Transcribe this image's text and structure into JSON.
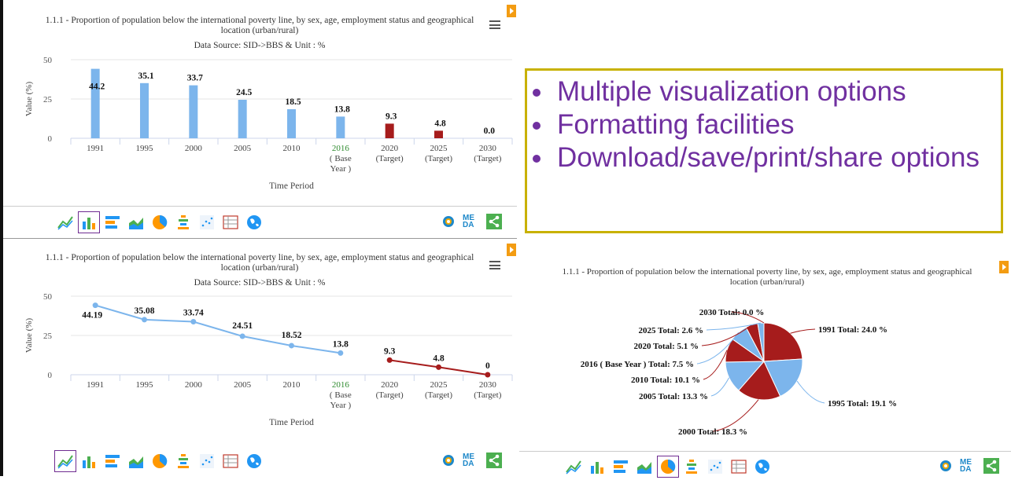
{
  "shared": {
    "title_line1": "1.1.1 - Proportion of population below the international poverty line, by sex, age, employment status and geographical",
    "title_line2": "location (urban/rural)",
    "source": "Data Source: SID->BBS & Unit : %",
    "xlabel": "Time Period",
    "ylabel": "Value (%)",
    "meta_label": "META DATA"
  },
  "callout": {
    "items": [
      "Multiple visualization options",
      "Formatting facilities",
      "Download/save/print/share options"
    ]
  },
  "colors": {
    "base": "#7cb5ec",
    "target": "#a61c1c",
    "accent_purple": "#7030a0",
    "gold_border": "#c8b100"
  },
  "toolbar_icons": [
    "line-chart-icon",
    "bar-chart-icon",
    "horizontal-bar-icon",
    "area-chart-icon",
    "pie-chart-icon",
    "pyramid-chart-icon",
    "scatter-chart-icon",
    "table-icon",
    "map-icon"
  ],
  "chart_data": [
    {
      "type": "bar",
      "categories": [
        "1991",
        "1995",
        "2000",
        "2005",
        "2010",
        "2016 ( Base Year )",
        "2020 (Target)",
        "2025 (Target)",
        "2030 (Target)"
      ],
      "values": [
        44.2,
        35.1,
        33.7,
        24.5,
        18.5,
        13.8,
        9.3,
        4.8,
        0.0
      ],
      "labels": [
        "44.2",
        "35.1",
        "33.7",
        "24.5",
        "18.5",
        "13.8",
        "9.3",
        "4.8",
        "0.0"
      ],
      "series_colors": [
        "#7cb5ec",
        "#7cb5ec",
        "#7cb5ec",
        "#7cb5ec",
        "#7cb5ec",
        "#7cb5ec",
        "#a61c1c",
        "#a61c1c",
        "#a61c1c"
      ],
      "ylim": [
        0,
        50
      ],
      "yticks": [
        0,
        25,
        50
      ]
    },
    {
      "type": "line",
      "categories": [
        "1991",
        "1995",
        "2000",
        "2005",
        "2010",
        "2016 ( Base Year )",
        "2020 (Target)",
        "2025 (Target)",
        "2030 (Target)"
      ],
      "series": [
        {
          "values": [
            44.19,
            35.08,
            33.74,
            24.51,
            18.52,
            13.8,
            null,
            null,
            null
          ],
          "color": "#7cb5ec"
        },
        {
          "values": [
            null,
            null,
            null,
            null,
            null,
            null,
            9.3,
            4.8,
            0
          ],
          "color": "#a61c1c"
        }
      ],
      "labels": [
        "44.19",
        "35.08",
        "33.74",
        "24.51",
        "18.52",
        "13.8",
        "9.3",
        "4.8",
        "0"
      ],
      "ylim": [
        0,
        50
      ],
      "yticks": [
        0,
        25,
        50
      ]
    },
    {
      "type": "pie",
      "slices": [
        {
          "label": "1991 Total: 24.0 %",
          "value": 24.0,
          "color": "#a61c1c"
        },
        {
          "label": "1995 Total: 19.1 %",
          "value": 19.1,
          "color": "#7cb5ec"
        },
        {
          "label": "2000 Total: 18.3 %",
          "value": 18.3,
          "color": "#a61c1c"
        },
        {
          "label": "2005 Total: 13.3 %",
          "value": 13.3,
          "color": "#7cb5ec"
        },
        {
          "label": "2010 Total: 10.1 %",
          "value": 10.1,
          "color": "#a61c1c"
        },
        {
          "label": "2016 ( Base Year ) Total: 7.5 %",
          "value": 7.5,
          "color": "#7cb5ec"
        },
        {
          "label": "2020 Total: 5.1 %",
          "value": 5.1,
          "color": "#a61c1c"
        },
        {
          "label": "2025 Total: 2.6 %",
          "value": 2.6,
          "color": "#7cb5ec"
        },
        {
          "label": "2030 Total: 0.0 %",
          "value": 0.0,
          "color": "#a61c1c"
        }
      ]
    }
  ]
}
